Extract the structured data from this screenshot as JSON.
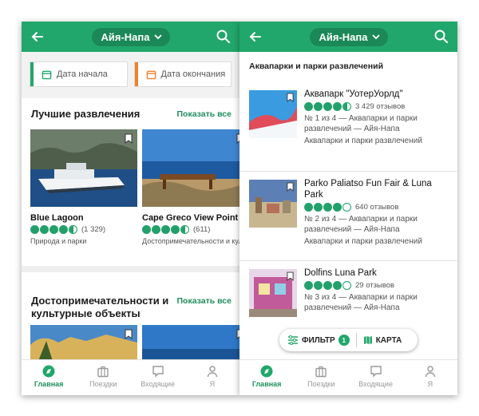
{
  "location": "Айя-Напа",
  "left": {
    "start_date": "Дата начала",
    "end_date": "Дата окончания",
    "section1": {
      "title": "Лучшие развлечения",
      "show_all": "Показать все",
      "cards": [
        {
          "name": "Blue Lagoon",
          "rating": 4.5,
          "reviews": "(1 329)",
          "category": "Природа и парки"
        },
        {
          "name": "Cape Greco View Point",
          "rating": 4.5,
          "reviews": "(611)",
          "category": "Достопримечательности и культурные объекты"
        }
      ]
    },
    "section2": {
      "title": "Достопримечательности и культурные объекты",
      "show_all": "Показать все"
    }
  },
  "right": {
    "list_title": "Аквапарки и парки развлечений",
    "items": [
      {
        "title": "Аквапарк \"УотерУорлд\"",
        "rating": 4.5,
        "reviews": "3 429 отзывов",
        "rank": "№ 1 из 4 — Аквапарки и парки развлечений — Айя-Напа",
        "category": "Аквапарки и парки развлечений"
      },
      {
        "title": "Parko Paliatso Fun Fair & Luna Park",
        "rating": 4.0,
        "reviews": "640 отзывов",
        "rank": "№ 2 из 4 — Аквапарки и парки развлечений — Айя-Напа",
        "category": "Аквапарки и парки развлечений"
      },
      {
        "title": "Dolfins Luna Park",
        "rating": 4.0,
        "reviews": "29 отзывов",
        "rank": "№ 3 из 4 — Аквапарки и парки развлечений — Айя-Напа",
        "category": "Аквапарки и парки развлечений"
      }
    ],
    "filter_label": "ФИЛЬТР",
    "filter_count": "1",
    "map_label": "КАРТА"
  },
  "nav": {
    "home": "Главная",
    "trips": "Поездки",
    "inbox": "Входящие",
    "me": "Я"
  },
  "colors": {
    "brand": "#21a76b",
    "link": "#1f8f5c",
    "start_bar": "#21a76b",
    "end_bar": "#f0812b"
  }
}
